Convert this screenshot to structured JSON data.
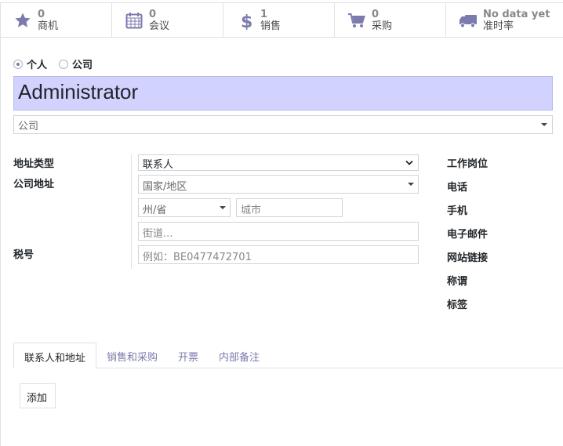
{
  "stats": [
    {
      "value": "0",
      "label": "商机",
      "icon": "star-icon"
    },
    {
      "value": "0",
      "label": "会议",
      "icon": "calendar-icon"
    },
    {
      "value": "1",
      "label": "销售",
      "icon": "dollar-icon"
    },
    {
      "value": "0",
      "label": "采购",
      "icon": "cart-icon"
    },
    {
      "value": "No data yet",
      "label": "准时率",
      "icon": "truck-icon"
    }
  ],
  "company_type": {
    "options": [
      "个人",
      "公司"
    ],
    "selected": "个人"
  },
  "partner_name": "Administrator",
  "parent_company": {
    "placeholder": "公司"
  },
  "left_labels": {
    "address_type": "地址类型",
    "company_address": "公司地址",
    "tax_id": "税号"
  },
  "address": {
    "type_value": "联系人",
    "country_placeholder": "国家/地区",
    "state_placeholder": "州/省",
    "city_placeholder": "城市",
    "street_placeholder": "街道...",
    "vat_placeholder": "例如：BE0477472701"
  },
  "right_labels": [
    "工作岗位",
    "电话",
    "手机",
    "电子邮件",
    "网站链接",
    "称谓",
    "标签"
  ],
  "tabs": [
    "联系人和地址",
    "销售和采购",
    "开票",
    "内部备注"
  ],
  "active_tab": "联系人和地址",
  "add_button": "添加",
  "colors": {
    "accent": "#7c7bad",
    "name_bg": "#d2d2ff"
  }
}
